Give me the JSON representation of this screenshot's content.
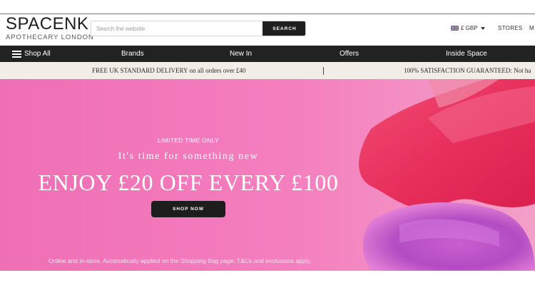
{
  "brand": {
    "logo_main": "SPACENK",
    "logo_sub": "APOTHECARY LONDON"
  },
  "search": {
    "placeholder": "Search the website",
    "value": "",
    "button_label": "SEARCH"
  },
  "header": {
    "currency_label": "£ GBP",
    "stores_label": "STORES",
    "more_label": "M"
  },
  "nav": {
    "shop_all_label": "Shop All",
    "items": [
      {
        "label": "Brands"
      },
      {
        "label": "New In"
      },
      {
        "label": "Offers"
      },
      {
        "label": "Inside Space"
      }
    ]
  },
  "promo_bar": {
    "items": [
      {
        "text": "FREE UK STANDARD DELIVERY on all orders over £40"
      },
      {
        "text": "100% SATISFACTION GUARANTEED: Not ha"
      }
    ]
  },
  "hero": {
    "eyebrow": "LIMITED TIME ONLY",
    "subtitle": "It's time for something new",
    "title": "ENJOY £20 OFF EVERY £100",
    "button_label": "SHOP NOW",
    "footnote": "Online and in-store. Automatically applied on the Shopping Bag page. T&Cs and exclusions apply."
  },
  "colors": {
    "accent_rule": "#e13a8c",
    "nav_bg": "#222222",
    "promo_bg": "#f2ede6",
    "hero_pink": "#f07ab9",
    "button_dark": "#1d1d1d"
  },
  "icons": [
    "menu-icon",
    "uk-flag-icon",
    "caret-down-icon"
  ]
}
